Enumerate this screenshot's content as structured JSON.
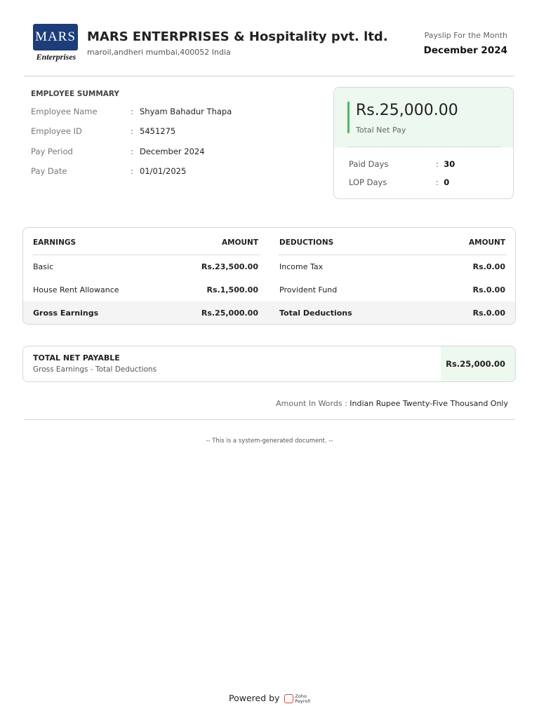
{
  "company": {
    "logo_text": "MARS",
    "logo_subtext": "Enterprises",
    "name": "MARS ENTERPRISES & Hospitality pvt. ltd.",
    "address": "maroil,andheri mumbai,400052 India"
  },
  "payslip": {
    "month_label": "Payslip For the Month",
    "month_value": "December 2024"
  },
  "employee_summary": {
    "title": "EMPLOYEE SUMMARY",
    "rows": [
      {
        "label": "Employee Name",
        "value": "Shyam Bahadur Thapa"
      },
      {
        "label": "Employee ID",
        "value": "5451275"
      },
      {
        "label": "Pay Period",
        "value": "December 2024"
      },
      {
        "label": "Pay Date",
        "value": "01/01/2025"
      }
    ]
  },
  "net_pay": {
    "amount": "Rs.25,000.00",
    "label": "Total Net Pay",
    "paid_days_label": "Paid Days",
    "paid_days": "30",
    "lop_days_label": "LOP Days",
    "lop_days": "0"
  },
  "earnings_table": {
    "earnings_header": "EARNINGS",
    "amount_header": "AMOUNT",
    "deductions_header": "DEDUCTIONS",
    "amount_header2": "AMOUNT",
    "rows": [
      {
        "earning": "Basic",
        "earning_amount": "Rs.23,500.00",
        "deduction": "Income Tax",
        "deduction_amount": "Rs.0.00"
      },
      {
        "earning": "House Rent Allowance",
        "earning_amount": "Rs.1,500.00",
        "deduction": "Provident Fund",
        "deduction_amount": "Rs.0.00"
      }
    ],
    "gross_label": "Gross Earnings",
    "gross_amount": "Rs.25,000.00",
    "total_deductions_label": "Total Deductions",
    "total_deductions_amount": "Rs.0.00"
  },
  "net_payable": {
    "title": "TOTAL NET PAYABLE",
    "subtitle": "Gross Earnings - Total Deductions",
    "amount": "Rs.25,000.00"
  },
  "amount_in_words": {
    "label": "Amount In Words :",
    "value": "Indian Rupee Twenty-Five Thousand Only"
  },
  "footer": {
    "system_note": "-- This is a system-generated document. --",
    "powered_by": "Powered by",
    "brand_top": "Zoho",
    "brand_bottom": "Payroll",
    "brand_icon": "zoho-payroll-icon"
  },
  "colors": {
    "accent_green": "#4cb860",
    "light_green": "#edf8ef",
    "logo_blue": "#1d3c7a"
  }
}
